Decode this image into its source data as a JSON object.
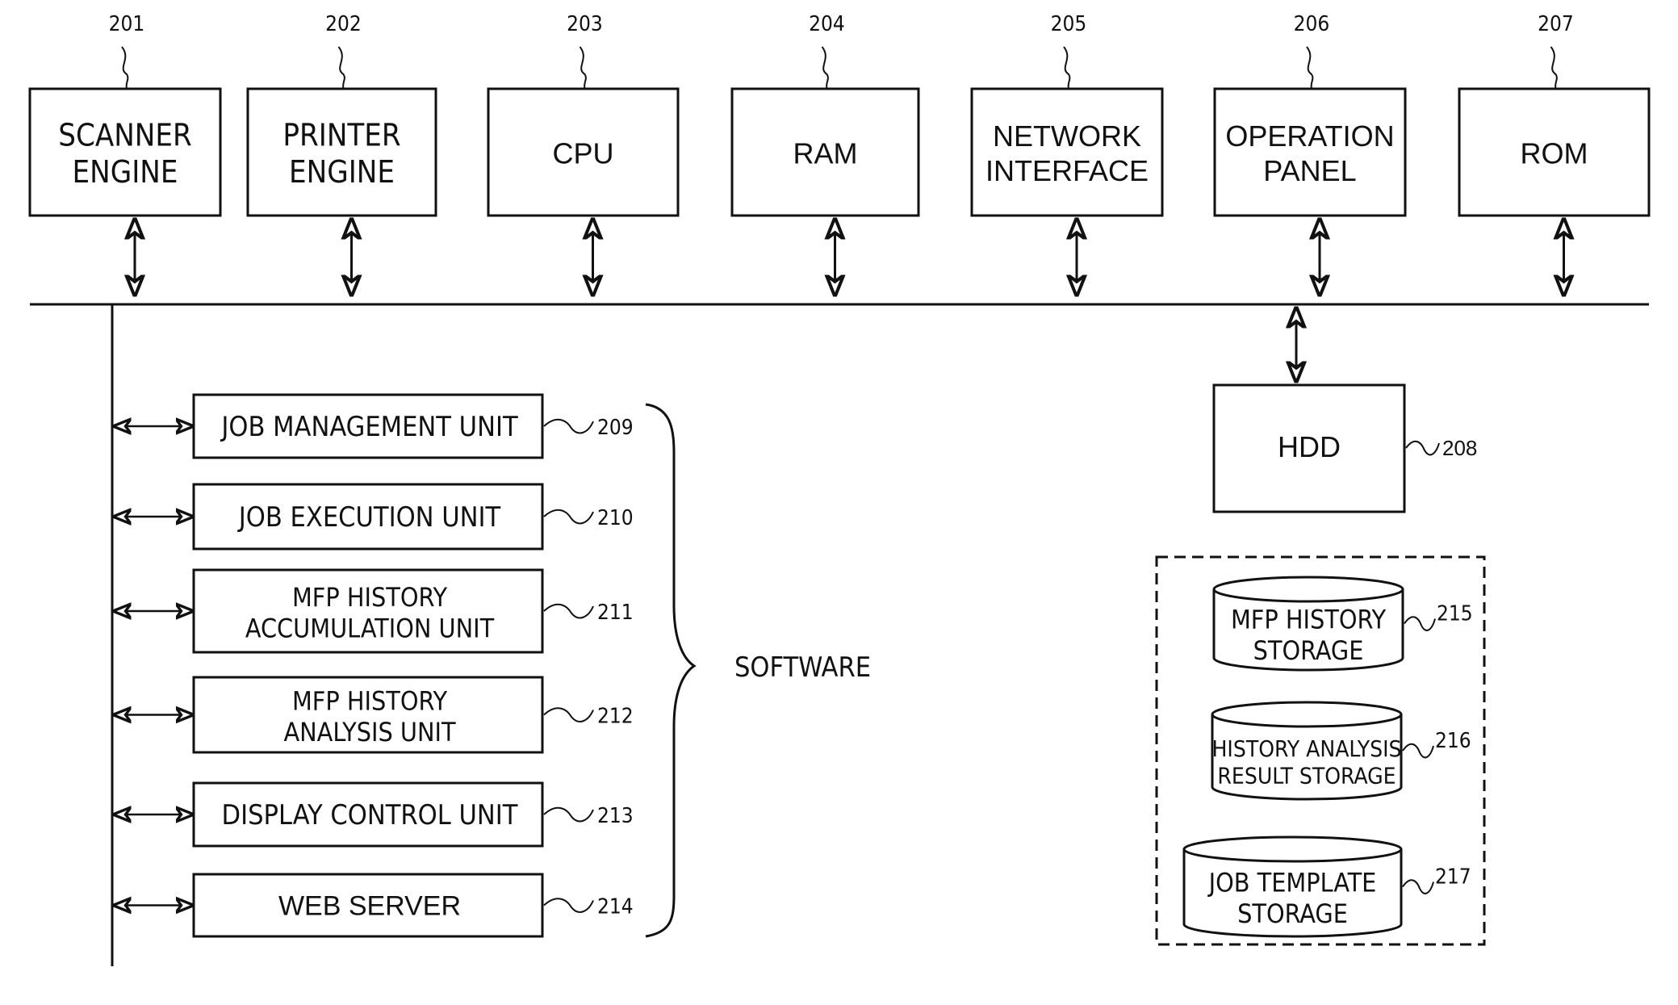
{
  "figure": {
    "hardware": [
      {
        "ref": "201",
        "lines": [
          "SCANNER",
          "ENGINE"
        ]
      },
      {
        "ref": "202",
        "lines": [
          "PRINTER",
          "ENGINE"
        ]
      },
      {
        "ref": "203",
        "lines": [
          "CPU"
        ]
      },
      {
        "ref": "204",
        "lines": [
          "RAM"
        ]
      },
      {
        "ref": "205",
        "lines": [
          "NETWORK",
          "INTERFACE"
        ]
      },
      {
        "ref": "206",
        "lines": [
          "OPERATION",
          "PANEL"
        ]
      },
      {
        "ref": "207",
        "lines": [
          "ROM"
        ]
      }
    ],
    "hdd": {
      "ref": "208",
      "label": "HDD"
    },
    "software_group_label": "SOFTWARE",
    "software": [
      {
        "ref": "209",
        "lines": [
          "JOB MANAGEMENT UNIT"
        ]
      },
      {
        "ref": "210",
        "lines": [
          "JOB EXECUTION UNIT"
        ]
      },
      {
        "ref": "211",
        "lines": [
          "MFP HISTORY",
          "ACCUMULATION UNIT"
        ]
      },
      {
        "ref": "212",
        "lines": [
          "MFP HISTORY",
          "ANALYSIS UNIT"
        ]
      },
      {
        "ref": "213",
        "lines": [
          "DISPLAY CONTROL UNIT"
        ]
      },
      {
        "ref": "214",
        "lines": [
          "WEB SERVER"
        ]
      }
    ],
    "storages": [
      {
        "ref": "215",
        "lines": [
          "MFP HISTORY",
          "STORAGE"
        ]
      },
      {
        "ref": "216",
        "lines": [
          "HISTORY ANALYSIS",
          "RESULT STORAGE"
        ]
      },
      {
        "ref": "217",
        "lines": [
          "JOB TEMPLATE",
          "STORAGE"
        ]
      }
    ]
  }
}
